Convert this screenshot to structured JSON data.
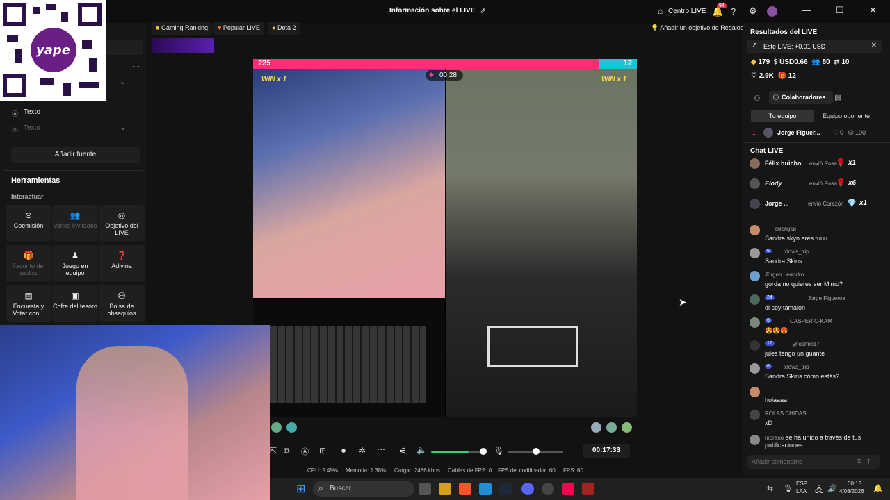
{
  "window": {
    "title": "Información sobre el LIVE",
    "centro_live": "Centro LIVE",
    "notif_count": "94"
  },
  "leftpanel": {
    "text_item": "Texto",
    "text_item2": "Texto",
    "add_source": "Añadir fuente",
    "tools_heading": "Herramientas",
    "interact_label": "Interactuar",
    "tools": [
      {
        "label": "Coemisión",
        "icon": "link-icon",
        "dim": false
      },
      {
        "label": "Varios invitados",
        "icon": "users-icon",
        "dim": true
      },
      {
        "label": "Objetivo del LIVE",
        "icon": "target-icon",
        "dim": false
      },
      {
        "label": "Favorito del público",
        "icon": "gift-icon",
        "dim": true
      },
      {
        "label": "Juego en equipo",
        "icon": "team-icon",
        "dim": false
      },
      {
        "label": "Adivina",
        "icon": "question-icon",
        "dim": false
      },
      {
        "label": "Encuesta y Votar con...",
        "icon": "poll-icon",
        "dim": false
      },
      {
        "label": "Cofre del tesoro",
        "icon": "chest-icon",
        "dim": false
      },
      {
        "label": "Bolsa de obsequios",
        "icon": "bag-icon",
        "dim": false
      }
    ]
  },
  "tags": [
    "Gaming Ranking",
    "Popular LIVE",
    "Dota 2"
  ],
  "goal_button": "Añadir un objetivo de Regalos",
  "battle": {
    "score_left": "225",
    "score_right": "12",
    "timer": "00:28",
    "win_left": "WIN x 1",
    "win_right": "WIN x 1"
  },
  "controls": {
    "elapsed": "00:17:33"
  },
  "stats": {
    "cpu": "CPU: 5.49%",
    "memoria": "Memoria: 1.38%",
    "cargar": "Cargar: 2486 kbps",
    "caidas": "Caídas de FPS: 0",
    "fps_cod": "FPS del codificador: 60",
    "fps": "FPS: 60"
  },
  "right": {
    "results_title": "Resultados del LIVE",
    "this_live": "Este LIVE: +0.01 USD",
    "metrics": [
      {
        "icon": "diamond-icon",
        "value": "179"
      },
      {
        "icon": "coin-icon",
        "value": "USD0.66"
      },
      {
        "icon": "people-icon",
        "value": "80"
      },
      {
        "icon": "share-icon",
        "value": "10"
      },
      {
        "icon": "heart-icon",
        "value": "2.9K"
      },
      {
        "icon": "gift-icon",
        "value": "12"
      }
    ],
    "collab_tab": "Colaboradores",
    "team_tab": "Tu equipo",
    "opp_tab": "Equipo oponente",
    "rank": {
      "pos": "1",
      "name": "Jorge Figuer...",
      "likes": "0",
      "score": "100"
    },
    "chat_title": "Chat LIVE",
    "gifts": [
      {
        "user": "Félix huicho",
        "action": "envió Rosa",
        "mult": "x1"
      },
      {
        "user": "Elody",
        "action": "envió Rosa",
        "mult": "x6"
      },
      {
        "user": "Jorge ...",
        "action": "envió Corazón",
        "mult": "x1"
      }
    ],
    "messages": [
      {
        "name": "ємєяgєи",
        "badge": "",
        "text": "Sandra skyn eres tuuu"
      },
      {
        "name": "xlows_trip",
        "badge": "6",
        "text": "Sandra Skins"
      },
      {
        "name": "Jürgen Leandro",
        "badge": "",
        "text": "gorda no quieres ser Mimo?"
      },
      {
        "name": "Jorge Figueroa",
        "badge": "24",
        "text": "di soy tamalon"
      },
      {
        "name": "CASPER C-KAM",
        "badge": "6",
        "text": "😍😍😍"
      },
      {
        "name": "yhosmel17",
        "badge": "17",
        "text": "jules tengo un guante"
      },
      {
        "name": "xlows_trip",
        "badge": "6",
        "text": "Sandra Skins cómo estás?"
      },
      {
        "name": "",
        "badge": "",
        "text": "holaaaa"
      },
      {
        "name": "ROLAS CHIDAS",
        "badge": "",
        "text": "xD"
      },
      {
        "name": "moreno",
        "badge": "",
        "text": "se ha unido a través de tus publicaciones"
      }
    ],
    "comment_placeholder": "Añadir comentario"
  },
  "taskbar": {
    "search": "Buscar",
    "lang": "ESP",
    "lang2": "LAA",
    "time": "00:13",
    "date": "4/08/2026"
  },
  "qr": {
    "brand": "yape"
  }
}
